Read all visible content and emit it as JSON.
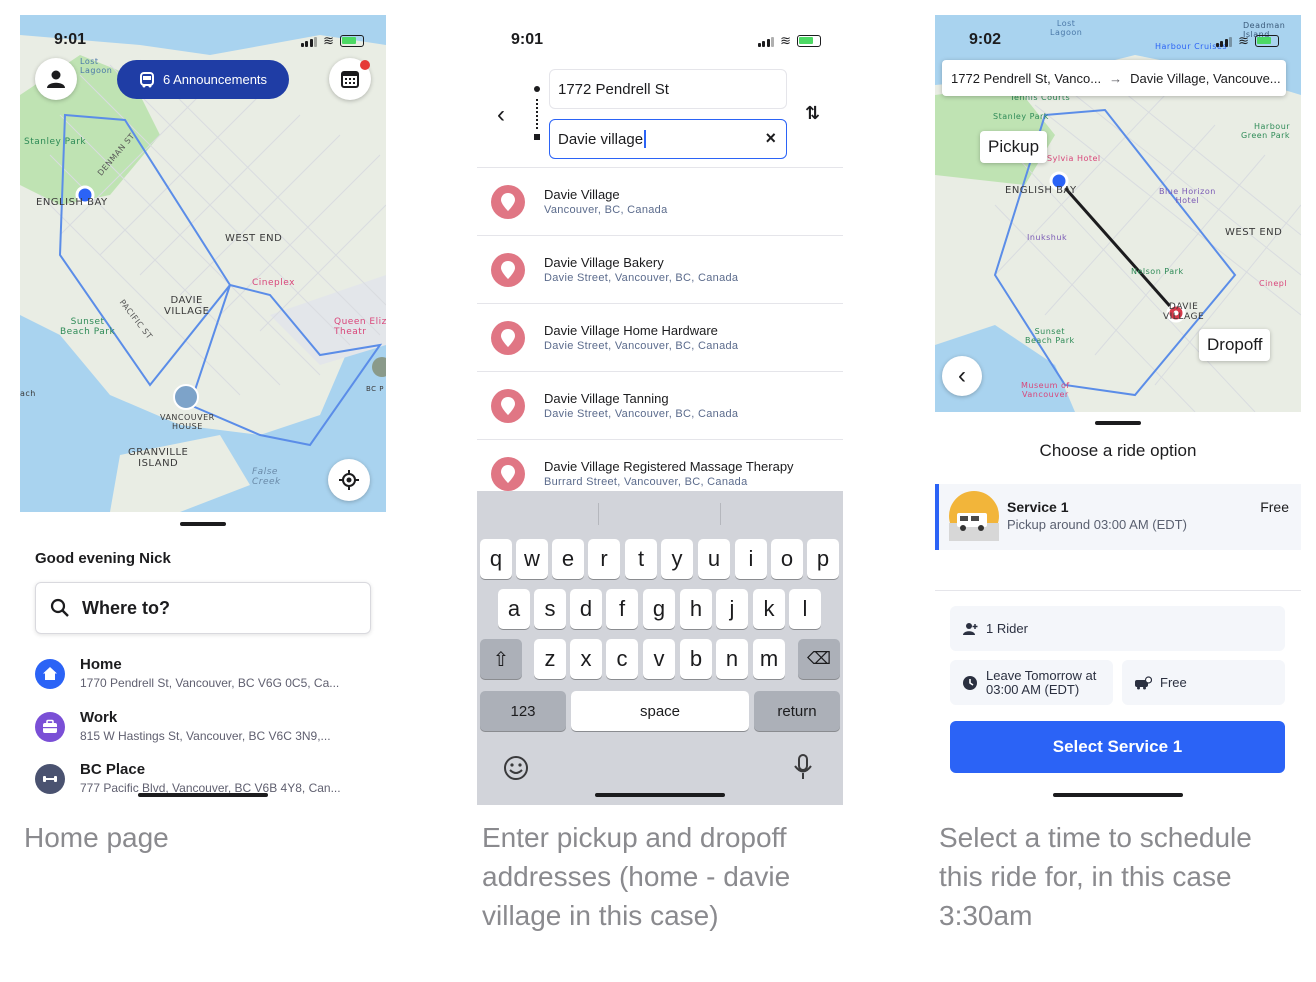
{
  "screen1": {
    "status_time": "9:01",
    "announcements_label": "6 Announcements",
    "map_labels": {
      "lost_lagoon": "Lost\nLagoon",
      "stanley_park": "Stanley Park",
      "english_bay": "ENGLISH BAY",
      "west_end": "WEST END",
      "davie_village": "DAVIE\nVILLAGE",
      "cineplex": "Cineplex",
      "queen_elizabeth": "Queen Eliz\nTheatr",
      "sunset_beach": "Sunset\nBeach Park",
      "vancouver_house": "VANCOUVER\nHOUSE",
      "granville_island": "GRANVILLE\nISLAND",
      "false_creek": "False\nCreek",
      "bc_place": "BC P",
      "denman": "DENMAN ST",
      "pacific": "PACIFIC ST",
      "ach": "ach"
    },
    "greeting": "Good evening Nick",
    "search_placeholder": "Where to?",
    "places": [
      {
        "title": "Home",
        "address": "1770 Pendrell St, Vancouver, BC V6G 0C5, Ca..."
      },
      {
        "title": "Work",
        "address": "815 W Hastings St, Vancouver, BC V6C 3N9,..."
      },
      {
        "title": "BC Place",
        "address": "777 Pacific Blvd, Vancouver, BC V6B 4Y8, Can..."
      }
    ],
    "colors": {
      "home": "#2b63f6",
      "work": "#7a4fd6",
      "bcplace": "#4a5270",
      "pill": "#1f3da5"
    }
  },
  "screen2": {
    "status_time": "9:01",
    "pickup_value": "1772 Pendrell St",
    "dropoff_value": "Davie village",
    "results": [
      {
        "title": "Davie Village",
        "subtitle": "Vancouver, BC, Canada"
      },
      {
        "title": "Davie Village Bakery",
        "subtitle": "Davie Street, Vancouver, BC, Canada"
      },
      {
        "title": "Davie Village Home Hardware",
        "subtitle": "Davie Street, Vancouver, BC, Canada"
      },
      {
        "title": "Davie Village Tanning",
        "subtitle": "Davie Street, Vancouver, BC, Canada"
      },
      {
        "title": "Davie Village Registered Massage Therapy",
        "subtitle": "Burrard Street, Vancouver, BC, Canada"
      }
    ],
    "keyboard": {
      "row1": [
        "q",
        "w",
        "e",
        "r",
        "t",
        "y",
        "u",
        "i",
        "o",
        "p"
      ],
      "row2": [
        "a",
        "s",
        "d",
        "f",
        "g",
        "h",
        "j",
        "k",
        "l"
      ],
      "row3": [
        "z",
        "x",
        "c",
        "v",
        "b",
        "n",
        "m"
      ],
      "numbers_label": "123",
      "space_label": "space",
      "return_label": "return"
    }
  },
  "screen3": {
    "status_time": "9:02",
    "from_short": "1772 Pendrell St, Vanco...",
    "to_short": "Davie Village, Vancouve...",
    "pickup_tag": "Pickup",
    "dropoff_tag": "Dropoff",
    "map_labels": {
      "lost_lagoon": "Lost\nLagoon",
      "deadman": "Deadman\nIsland",
      "harbour_cruises": "Harbour Cruises",
      "tennis": "Tennis Courts",
      "stanley_park": "Stanley Park",
      "harbour_green": "Harbour\nGreen Park",
      "sylvia": "Sylvia Hotel",
      "english_bay": "ENGLISH BAY",
      "blue_horizon": "Blue Horizon\nHotel",
      "west_end": "WEST END",
      "inukshuk": "Inukshuk",
      "nelson_park": "Nelson Park",
      "cineplex": "Cinepl",
      "davie_village": "DAVIE\nVILLAGE",
      "sunset_beach": "Sunset\nBeach Park",
      "museum": "Museum of\nVancouver"
    },
    "title": "Choose a ride option",
    "service_name": "Service 1",
    "service_price": "Free",
    "service_pickup": "Pickup around 03:00 AM (EDT)",
    "riders": "1 Rider",
    "leave": "Leave Tomorrow at\n03:00 AM (EDT)",
    "fare": "Free",
    "select_label": "Select Service 1",
    "colors": {
      "primary": "#2b63f6",
      "route": "#1c1c1e",
      "dropoff_pin": "#d63a4a"
    }
  },
  "captions": [
    "Home page",
    "Enter pickup and dropoff addresses (home - davie village in this case)",
    "Select a time to schedule this ride for, in this case 3:30am"
  ]
}
